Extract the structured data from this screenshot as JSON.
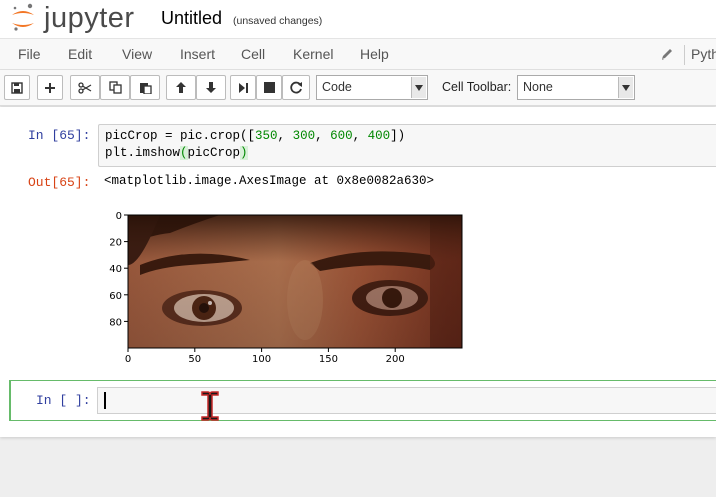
{
  "header": {
    "logo_text": "jupyter",
    "notebook_name": "Untitled",
    "save_status": "(unsaved changes)"
  },
  "menu": {
    "items": [
      "File",
      "Edit",
      "View",
      "Insert",
      "Cell",
      "Kernel",
      "Help"
    ],
    "kernel_name": "Python"
  },
  "toolbar": {
    "cell_type": "Code",
    "cell_toolbar_label": "Cell Toolbar:",
    "cell_toolbar_value": "None"
  },
  "cells": [
    {
      "in_prompt": "In [65]:",
      "code_lines": [
        "picCrop = pic.crop([350, 300, 600, 400])",
        "plt.imshow(picCrop)"
      ],
      "out_prompt": "Out[65]:",
      "out_text": "<matplotlib.image.AxesImage at 0x8e0082a630>",
      "plot": {
        "y_ticks": [
          "0",
          "20",
          "40",
          "60",
          "80"
        ],
        "x_ticks": [
          "0",
          "50",
          "100",
          "150",
          "200"
        ],
        "image_description_icon": "cropped-eyes-photo"
      }
    },
    {
      "in_prompt": "In [ ]:",
      "code": ""
    }
  ],
  "colors": {
    "in_prompt": "#303f9f",
    "out_prompt": "#d84315",
    "edit_mode_border": "#66bb6a",
    "logo_orange": "#f37726"
  }
}
